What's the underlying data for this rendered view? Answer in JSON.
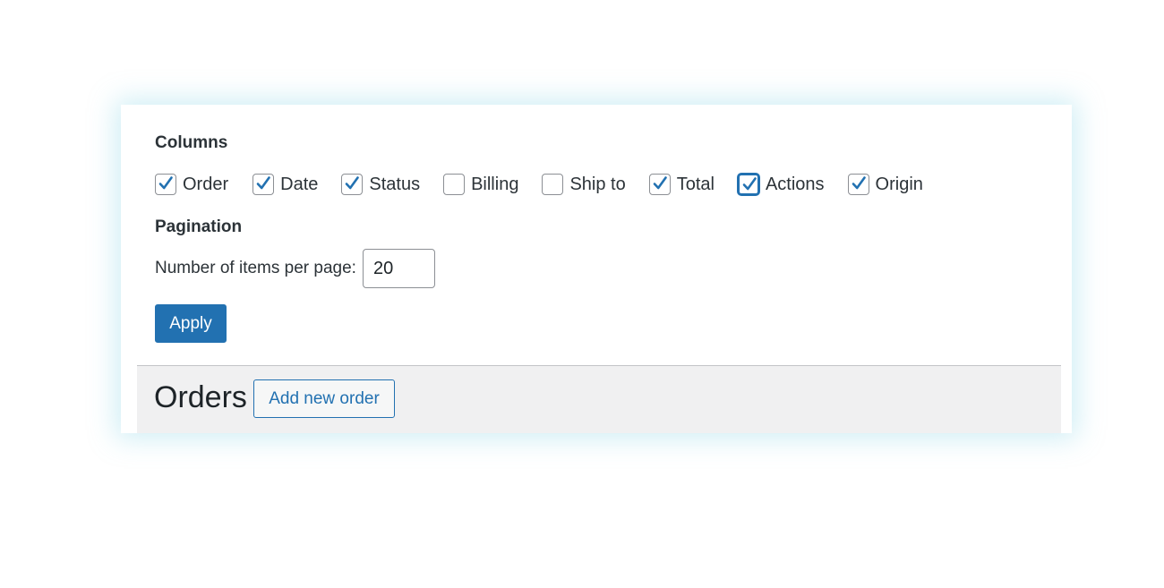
{
  "screen_options": {
    "columns_title": "Columns",
    "columns": [
      {
        "label": "Order",
        "checked": true
      },
      {
        "label": "Date",
        "checked": true
      },
      {
        "label": "Status",
        "checked": true
      },
      {
        "label": "Billing",
        "checked": false
      },
      {
        "label": "Ship to",
        "checked": false
      },
      {
        "label": "Total",
        "checked": true
      },
      {
        "label": "Actions",
        "checked": true
      },
      {
        "label": "Origin",
        "checked": true
      }
    ],
    "pagination_title": "Pagination",
    "items_per_page_label": "Number of items per page:",
    "items_per_page_value": "20",
    "apply_label": "Apply"
  },
  "orders_header": {
    "title": "Orders",
    "add_new_label": "Add new order"
  },
  "colors": {
    "accent": "#2271b1",
    "checkbox_border": "#8c8f94",
    "header_background": "#f0f0f1",
    "panel_glow": "#78cde1"
  }
}
